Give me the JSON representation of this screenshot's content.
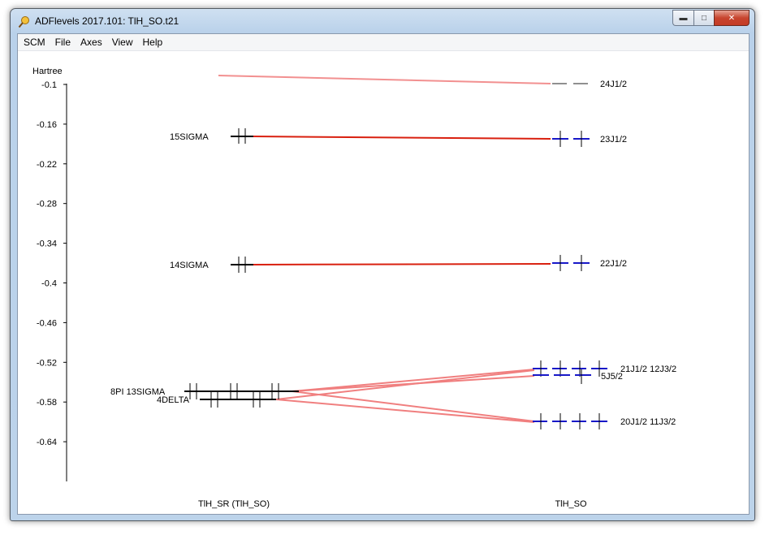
{
  "window": {
    "title": "ADFlevels 2017.101: TlH_SO.t21"
  },
  "menu": [
    "SCM",
    "File",
    "Axes",
    "View",
    "Help"
  ],
  "axis": {
    "unit": "Hartree",
    "ticks": [
      "-0.1",
      "-0.16",
      "-0.22",
      "-0.28",
      "-0.34",
      "-0.4",
      "-0.46",
      "-0.52",
      "-0.58",
      "-0.64"
    ]
  },
  "columns": {
    "left": "TlH_SR (TlH_SO)",
    "right": "TlH_SO"
  },
  "left_labels": {
    "15sigma": "15SIGMA",
    "14sigma": "14SIGMA",
    "8pi_13sigma": "8PI 13SIGMA",
    "4delta": "4DELTA"
  },
  "right_labels": {
    "24j": "24J1/2",
    "23j": "23J1/2",
    "22j": "22J1/2",
    "21j_12j": "21J1/2 12J3/2",
    "5j": "5J5/2",
    "20j_11j": "20J1/2 11J3/2"
  },
  "colors": {
    "correlation_strong": "#d9200f",
    "correlation_weak": "#f07f7f",
    "so_level": "#1818c8",
    "sr_level": "#000000",
    "virtual_level": "#909090"
  }
}
